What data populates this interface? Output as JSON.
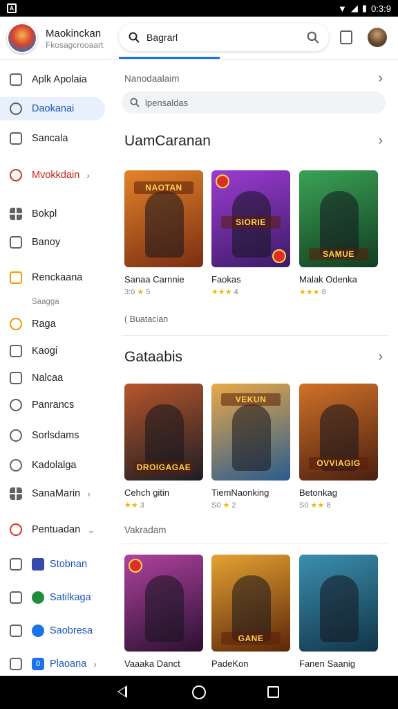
{
  "status_bar": {
    "time": "0:3:9",
    "left_icon": "A"
  },
  "header": {
    "app_name": "Maokinckan",
    "app_sub": "Fkosagcrooaart",
    "search_text": "Bagrarl"
  },
  "sidebar": {
    "items": [
      {
        "label": "Aplk Apolaia",
        "icon": "doc-icon"
      },
      {
        "label": "Daokanai",
        "icon": "person-icon",
        "active": true
      },
      {
        "label": "Sancala",
        "icon": "box-icon"
      },
      {
        "label": "Mvokkdain",
        "icon": "refresh-icon",
        "chevron": "›"
      },
      {
        "label": "Bokpl",
        "icon": "grid-icon"
      },
      {
        "label": "Banoy",
        "icon": "tag-icon"
      },
      {
        "label": "Renckaana",
        "icon": "star-icon"
      },
      {
        "label": "Raga",
        "icon": "clock-icon"
      },
      {
        "label": "Kaogi",
        "icon": "file-icon"
      },
      {
        "label": "Nalcaa",
        "icon": "crossbox-icon"
      },
      {
        "label": "Panrancs",
        "icon": "history-icon"
      },
      {
        "label": "Sorlsdams",
        "icon": "schedule-icon"
      },
      {
        "label": "Kadolalga",
        "icon": "alarm-icon"
      },
      {
        "label": "SanaMarin",
        "icon": "grid-icon",
        "chevron": "›"
      },
      {
        "label": "Pentuadan",
        "icon": "target-icon",
        "chevron": "⌄"
      },
      {
        "label": "Stobnan",
        "icon": "list-icon",
        "sub_icon": "star-badge-icon"
      },
      {
        "label": "Satilkaga",
        "icon": "lock-icon",
        "sub_icon": "green-circle-icon"
      },
      {
        "label": "Saobresa",
        "icon": "list-icon",
        "sub_icon": "blue-circle-icon"
      },
      {
        "label": "Plaoana",
        "icon": "list-icon",
        "sub_icon": "blue-badge-icon",
        "sub_text": "0",
        "chevron": "›"
      }
    ],
    "caption": "Saagga"
  },
  "main": {
    "row_title": "Nanodaalaim",
    "filter_text": "lpensaldas",
    "section1": {
      "title": "UamCaranan",
      "cards": [
        {
          "title": "Sanaa Carnnie",
          "meta": "3:0",
          "rating": "5",
          "banner": "NAOTAN",
          "colors": [
            "#7a2e12",
            "#e3832a"
          ]
        },
        {
          "title": "Faokas",
          "meta": "",
          "rating": "4",
          "banner": "SIORIE",
          "colors": [
            "#3b1c67",
            "#9d3bd1"
          ]
        },
        {
          "title": "Malak Odenka",
          "meta": "",
          "rating": "8",
          "banner": "SAMUE",
          "colors": [
            "#123d22",
            "#3aa355"
          ]
        }
      ],
      "more_text": "Buatacian"
    },
    "section2": {
      "title": "Gataabis",
      "cards": [
        {
          "title": "Cehch gitin",
          "meta": "",
          "rating": "3",
          "banner": "DROIGAGAE",
          "colors": [
            "#1d1d24",
            "#b6562a"
          ]
        },
        {
          "title": "TiemNaonking",
          "meta": "S0",
          "rating": "2",
          "banner": "VEKUN",
          "colors": [
            "#2a5b8e",
            "#e9a948"
          ]
        },
        {
          "title": "Betonkag",
          "meta": "S0",
          "rating": "8",
          "banner": "OVVIAGIG",
          "colors": [
            "#4a1f10",
            "#d07128"
          ]
        }
      ]
    },
    "row_title2": "Vakradam",
    "section3": {
      "cards": [
        {
          "title": "Vaaaka Danct",
          "banner": "",
          "colors": [
            "#2a1030",
            "#b0429f"
          ]
        },
        {
          "title": "PadeKon",
          "banner": "GANE",
          "colors": [
            "#5a2608",
            "#e5a233"
          ]
        },
        {
          "title": "Fanen Saanig",
          "banner": "",
          "colors": [
            "#123547",
            "#3b8fb0"
          ]
        }
      ]
    }
  }
}
